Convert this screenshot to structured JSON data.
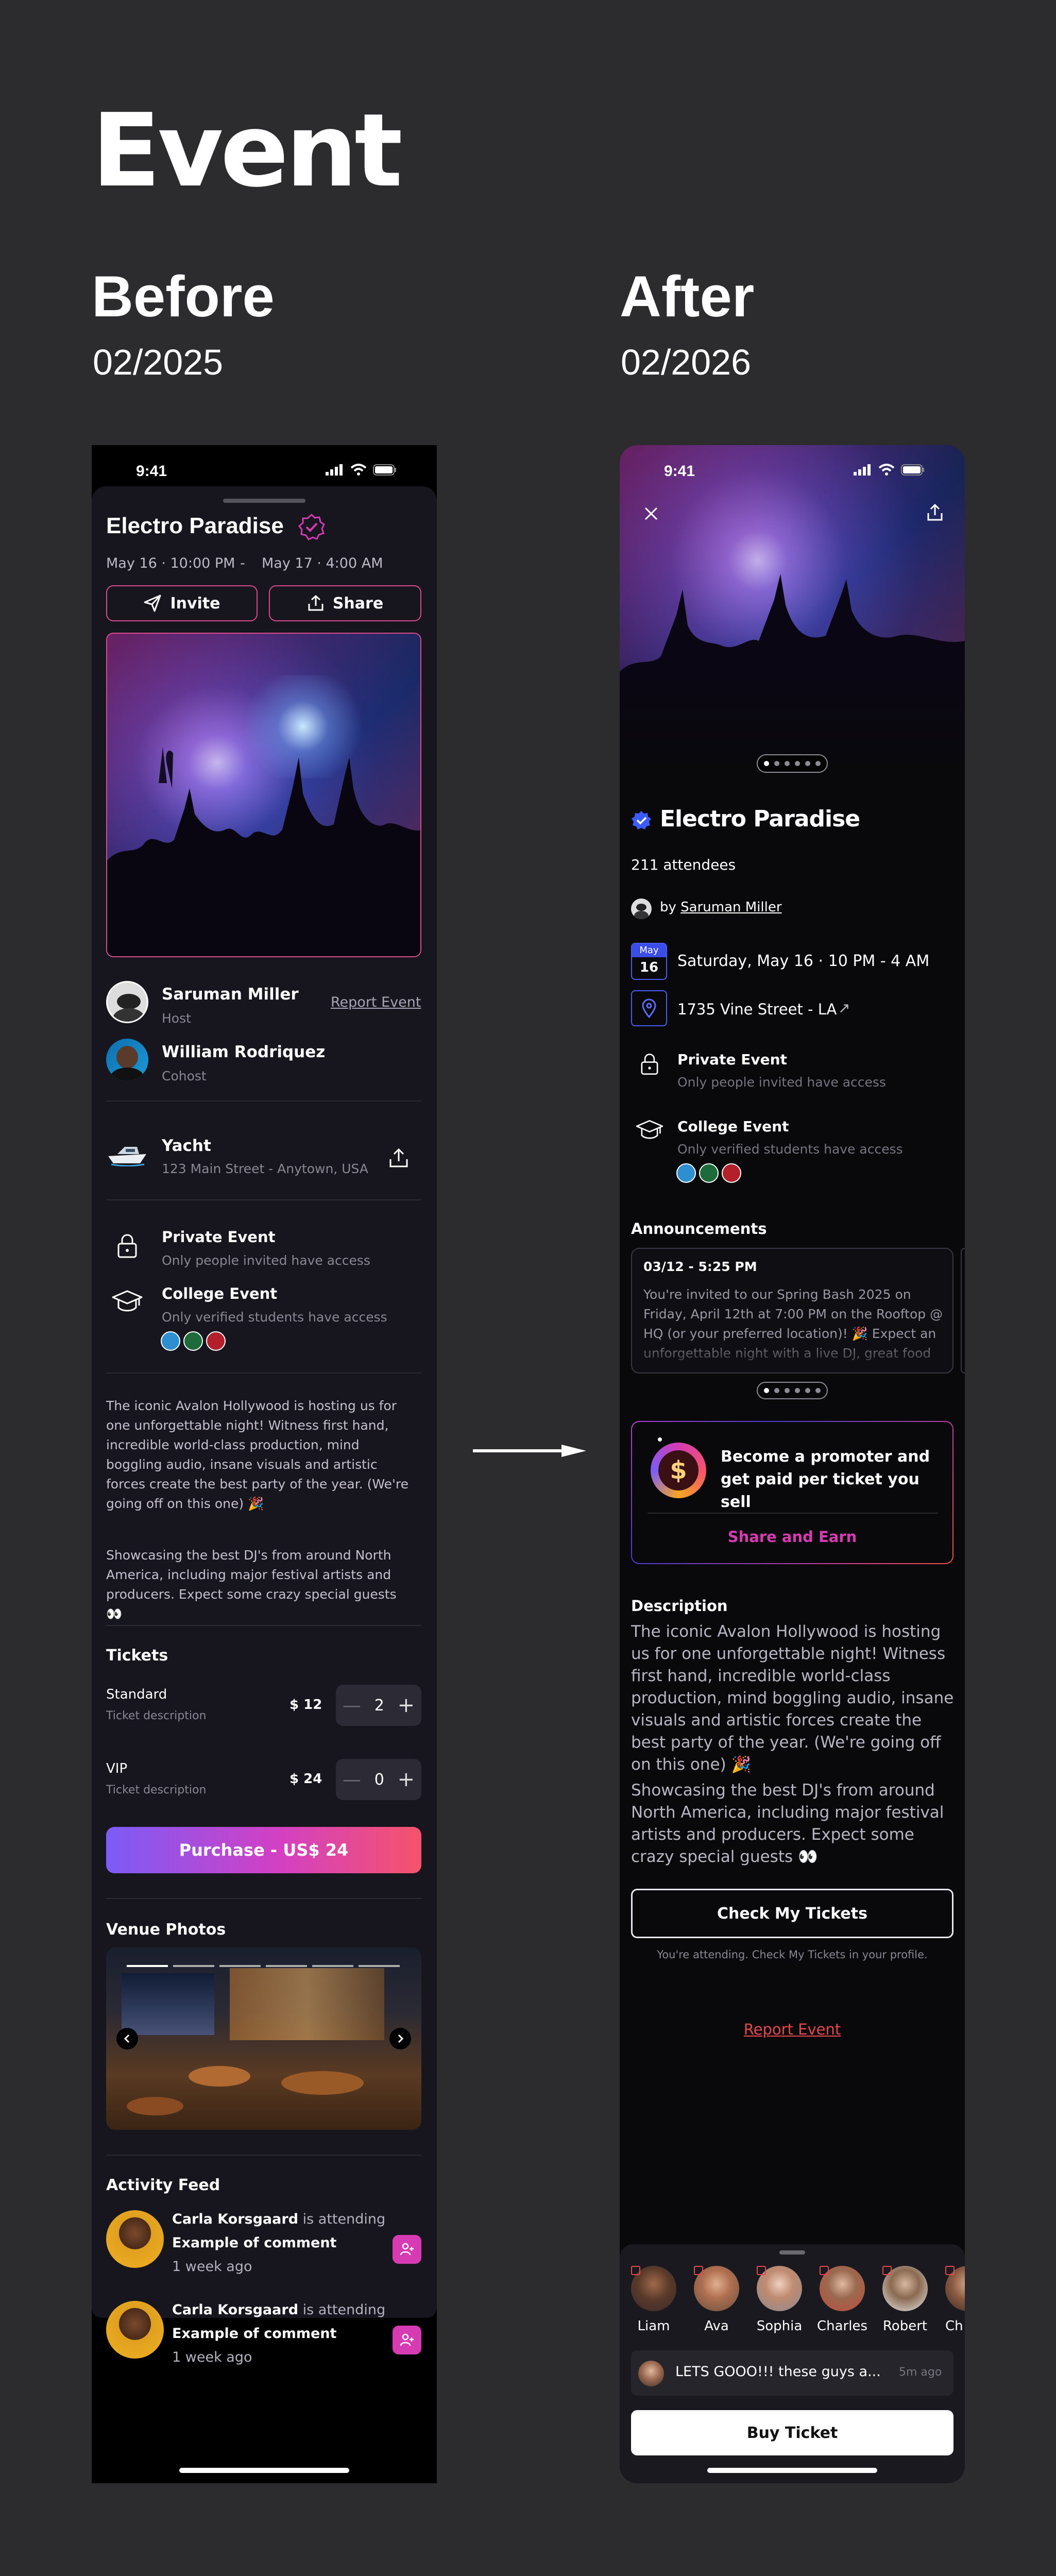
{
  "header": {
    "title": "Event"
  },
  "before": {
    "label": "Before",
    "date": "02/2025",
    "status_time": "9:41",
    "event_title": "Electro Paradise",
    "start": "May 16 · 10:00 PM",
    "date_sep": "-",
    "end": "May 17 · 4:00 AM",
    "invite_label": "Invite",
    "share_label": "Share",
    "host_name": "Saruman Miller",
    "host_role": "Host",
    "report_label": "Report Event",
    "cohost_name": "William Rodriquez",
    "cohost_role": "Cohost",
    "venue_name": "Yacht",
    "venue_address": "123 Main Street - Anytown, USA",
    "private_title": "Private Event",
    "private_sub": "Only people invited have access",
    "college_title": "College Event",
    "college_sub": "Only verified students have access",
    "description_1": "The iconic Avalon Hollywood is hosting us for one unforgettable night! Witness first hand, incredible world-class production, mind boggling audio, insane visuals and artistic forces create the best party of the year. (We're going off on this one) 🎉",
    "description_2": "Showcasing the best DJ's from around North America, including major festival artists and producers. Expect some crazy special guests 👀",
    "tickets_title": "Tickets",
    "ticket1_name": "Standard",
    "ticket1_desc": "Ticket description",
    "ticket1_price": "$ 12",
    "ticket1_qty": "2",
    "ticket2_name": "VIP",
    "ticket2_desc": "Ticket description",
    "ticket2_price": "$ 24",
    "ticket2_qty": "0",
    "stepper_minus": "—",
    "stepper_plus": "+",
    "purchase_label": "Purchase - US$ 24",
    "venue_photos_title": "Venue Photos",
    "activity_title": "Activity Feed",
    "feed": [
      {
        "name": "Carla Korsgaard",
        "action": "is attending",
        "comment": "Example of comment",
        "time": "1 week ago"
      },
      {
        "name": "Carla Korsgaard",
        "action": "is attending",
        "comment": "Example of comment",
        "time": "1 week ago"
      }
    ]
  },
  "after": {
    "label": "After",
    "date": "02/2026",
    "status_time": "9:41",
    "event_title": "Electro Paradise",
    "attendees": "211 attendees",
    "by_label": "by",
    "host_name": "Saruman Miller",
    "cal_month": "May",
    "cal_day": "16",
    "datetime": "Saturday, May 16  ·  10 PM - 4 AM",
    "address": "1735 Vine Street - LA",
    "external_arrow": "↗",
    "private_title": "Private Event",
    "private_sub": "Only people invited have access",
    "college_title": "College Event",
    "college_sub": "Only verified students have access",
    "announcements_title": "Announcements",
    "announcement_date": "03/12 - 5:25 PM",
    "announcement_text": "You're invited to our Spring Bash 2025 on Friday, April 12th at 7:00 PM on the Rooftop @ HQ (or your preferred location)! 🎉 Expect an unforgettable night with a live DJ, great food",
    "promoter_title": "Become a promoter and get paid per ticket you sell",
    "promoter_cta": "Share and Earn",
    "description_title": "Description",
    "description_1": "The iconic Avalon Hollywood is hosting us for one unforgettable night! Witness first hand, incredible world-class production, mind boggling audio, insane visuals and artistic forces create the best party of the year. (We're going off on this one) 🎉",
    "description_2": "Showcasing the best DJ's from around North America, including major festival artists and producers. Expect some crazy special guests 👀",
    "check_tickets_label": "Check My Tickets",
    "attending_note": "You're attending. Check My Tickets in your profile.",
    "report_label": "Report Event",
    "attendees_row": [
      "Liam",
      "Ava",
      "Sophia",
      "Charles",
      "Robert",
      "Ch"
    ],
    "chat_text": "LETS GOOO!!! these guys a...",
    "chat_time": "5m ago",
    "buy_label": "Buy Ticket"
  },
  "colors": {
    "background": "#2c2c2e",
    "accent_pink": "#d63bb3",
    "report_red": "#e5484d",
    "verified_blue": "#3b5bfd"
  },
  "icons": [
    "paper-plane-icon",
    "share-icon",
    "verified-badge-icon",
    "lock-icon",
    "graduation-cap-icon",
    "boat-icon",
    "upload-icon",
    "close-icon",
    "calendar-icon",
    "location-pin-icon",
    "coin-icon",
    "user-plus-icon",
    "chevron-left-icon",
    "chevron-right-icon"
  ]
}
